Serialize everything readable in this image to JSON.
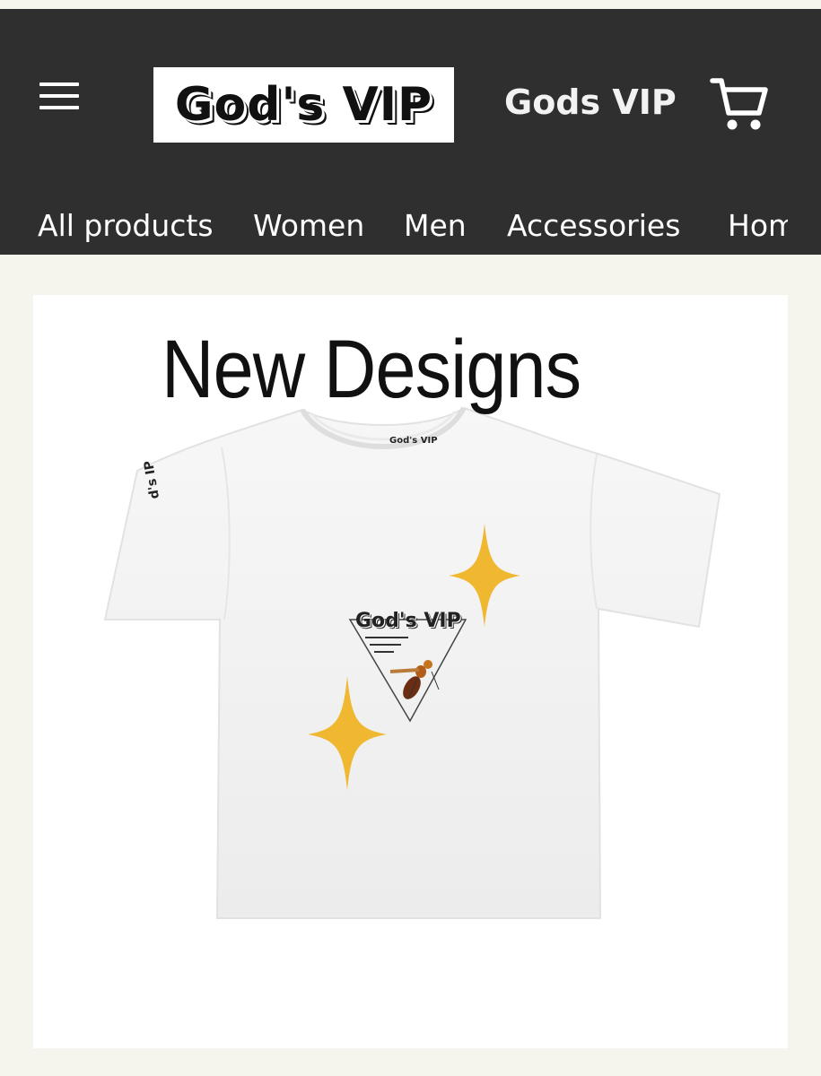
{
  "header": {
    "logo_text": "God's VIP",
    "brand_name": "Gods VIP",
    "menu_icon": "hamburger-menu-icon",
    "cart_icon": "shopping-cart-icon",
    "background_color": "#2f2f2f"
  },
  "nav": {
    "items": [
      {
        "label": "All products"
      },
      {
        "label": "Women"
      },
      {
        "label": "Men"
      },
      {
        "label": "Accessories"
      },
      {
        "label": "Hom"
      }
    ]
  },
  "hero": {
    "title": "New Designs",
    "shirt": {
      "collar_label": "God's VIP",
      "sleeve_text": "d's\nIP",
      "print_text": "God's VIP",
      "print_mark": "VIP",
      "sparkle_color": "#f0b730"
    }
  }
}
